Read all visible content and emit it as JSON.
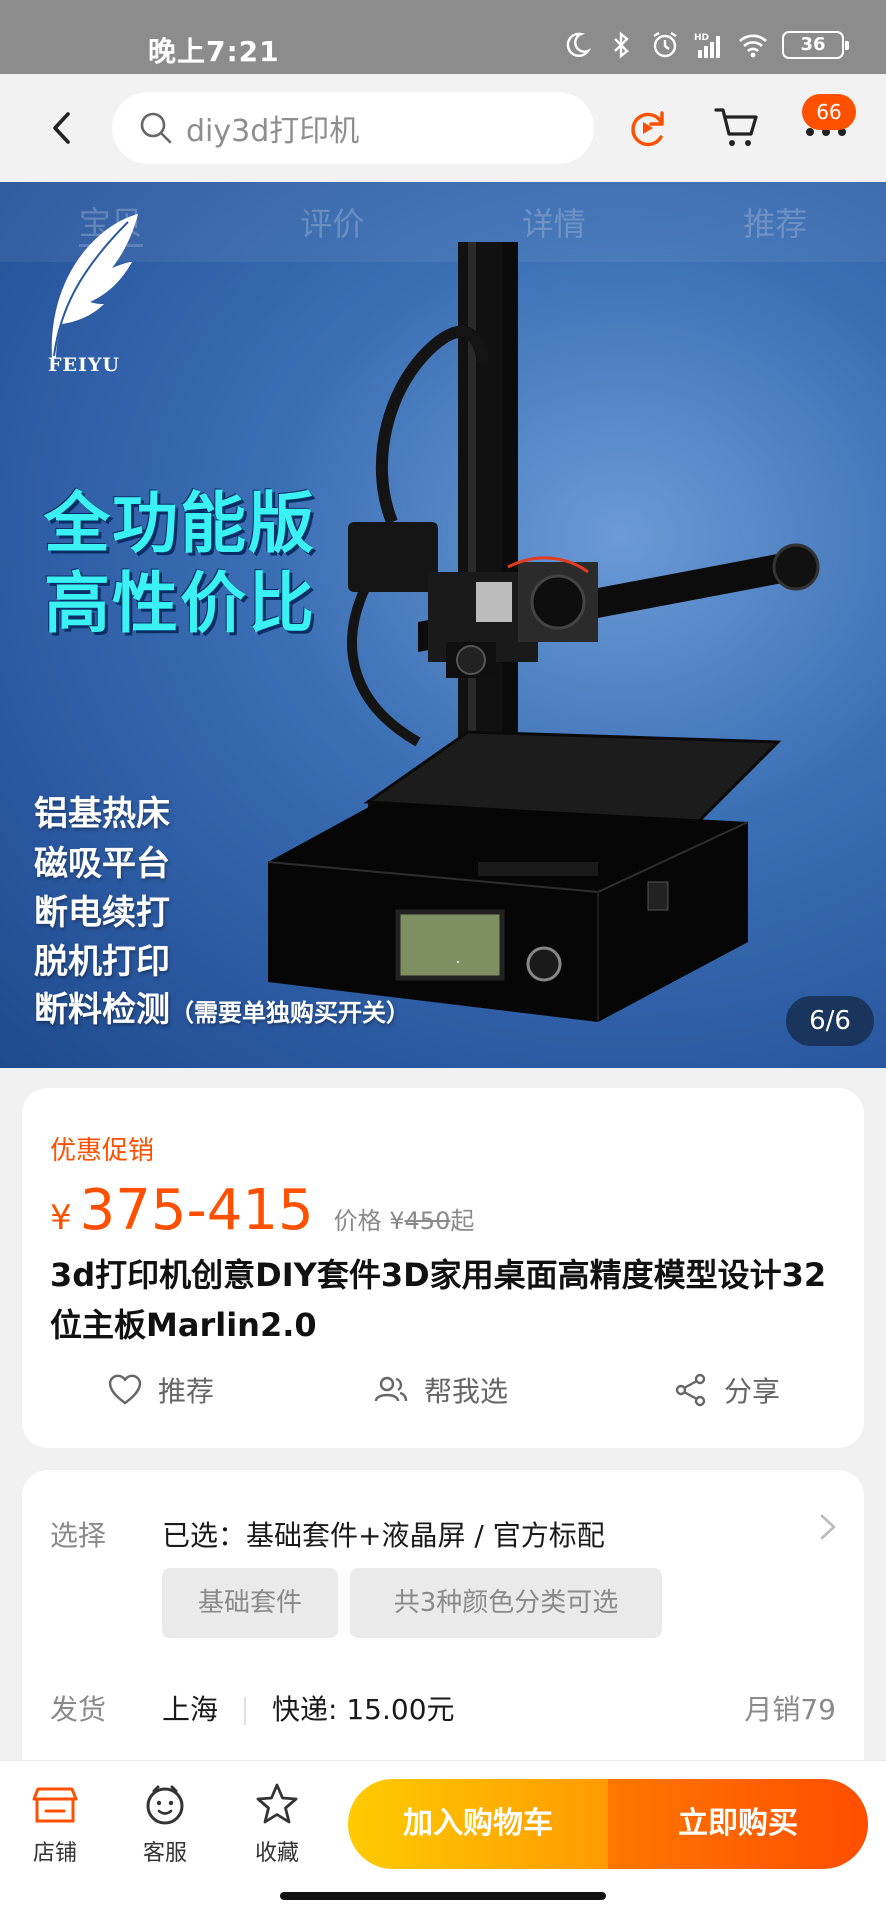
{
  "status_bar": {
    "time": "晚上7:21",
    "battery": "36",
    "icons": [
      "moon-icon",
      "bluetooth-icon",
      "alarm-icon",
      "hd-signal-icon",
      "wifi-icon",
      "battery-icon"
    ]
  },
  "nav": {
    "search_placeholder": "diy3d打印机",
    "cart_badge": "66",
    "icons": [
      "back-icon",
      "search-icon",
      "refresh-icon",
      "cart-icon",
      "more-icon"
    ]
  },
  "hero": {
    "tabs": [
      "宝贝",
      "评价",
      "详情",
      "推荐"
    ],
    "logo_text": "FEIYU",
    "headline_1": "全功能版",
    "headline_2": "高性价比",
    "features": [
      "铝基热床",
      "磁吸平台",
      "断电续打",
      "脱机打印",
      "断料检测"
    ],
    "feature_note": "（需要单独购买开关）",
    "page_indicator": "6/6"
  },
  "product": {
    "promo_label": "优惠促销",
    "currency": "¥",
    "price_range": "375-415",
    "orig_label": "价格 ¥",
    "orig_value": "450",
    "orig_suffix": "起",
    "title": "3d打印机创意DIY套件3D家用桌面高精度模型设计32位主板Marlin2.0",
    "actions": {
      "recommend": "推荐",
      "help_choose": "帮我选",
      "share": "分享"
    }
  },
  "spec": {
    "select_label": "选择",
    "selected_value": "已选：基础套件+液晶屏 / 官方标配",
    "chips": [
      "基础套件",
      "共3种颜色分类可选"
    ],
    "ship_label": "发货",
    "ship_from": "上海",
    "express": "快递: 15.00元",
    "monthly_sales": "月销79"
  },
  "bottom_bar": {
    "shop": "店铺",
    "service": "客服",
    "favorite": "收藏",
    "add_to_cart": "加入购物车",
    "buy_now": "立即购买"
  },
  "colors": {
    "accent": "#ff5000",
    "cart_button": "#ffb000",
    "buy_button": "#ff5a00"
  }
}
